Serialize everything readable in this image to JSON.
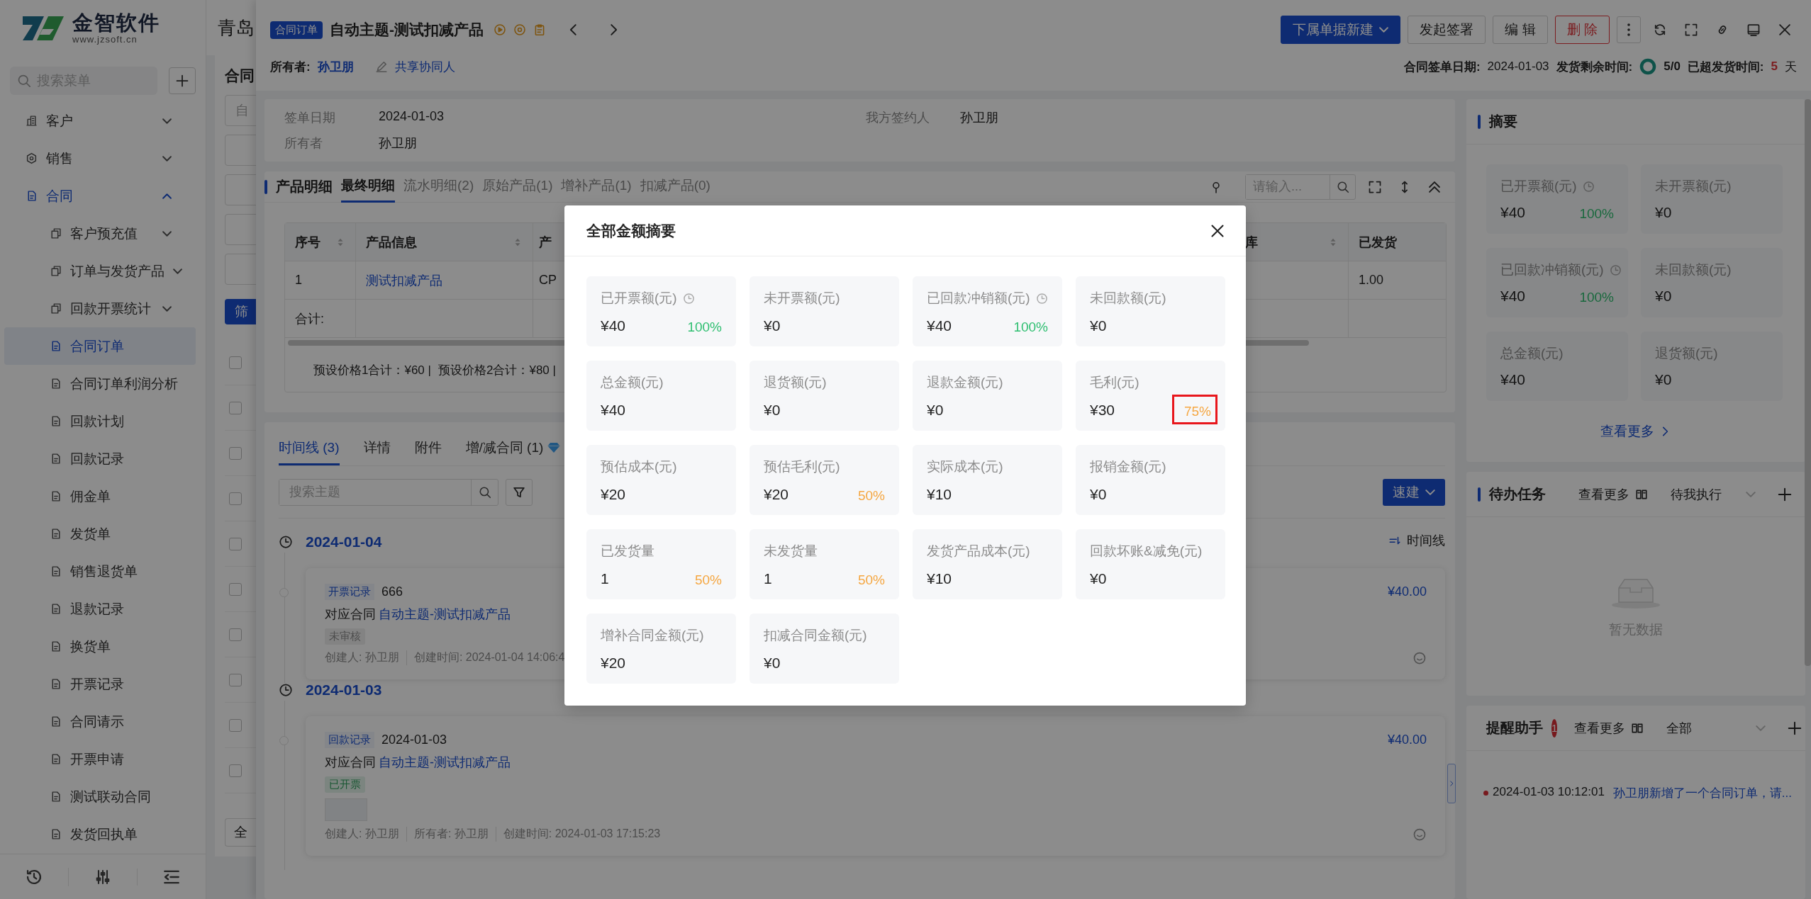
{
  "sidebar": {
    "logo": {
      "brand": "金智软件",
      "url": "www.jzsoft.cn"
    },
    "search": {
      "placeholder": "搜索菜单"
    },
    "items": [
      {
        "label": "客户",
        "expanded": false
      },
      {
        "label": "销售",
        "expanded": false
      },
      {
        "label": "合同",
        "expanded": true,
        "children": [
          {
            "label": "客户预充值",
            "kind": "group",
            "expanded": false,
            "selected": false
          },
          {
            "label": "订单与发货产品",
            "kind": "group",
            "expanded": false,
            "selected": false
          },
          {
            "label": "回款开票统计",
            "kind": "group",
            "expanded": false,
            "selected": false
          },
          {
            "label": "合同订单",
            "kind": "page",
            "selected": true
          },
          {
            "label": "合同订单利润分析",
            "kind": "page",
            "selected": false
          },
          {
            "label": "回款计划",
            "kind": "page",
            "selected": false
          },
          {
            "label": "回款记录",
            "kind": "page",
            "selected": false
          },
          {
            "label": "佣金单",
            "kind": "page",
            "selected": false
          },
          {
            "label": "发货单",
            "kind": "page",
            "selected": false
          },
          {
            "label": "销售退货单",
            "kind": "page",
            "selected": false
          },
          {
            "label": "退款记录",
            "kind": "page",
            "selected": false
          },
          {
            "label": "换货单",
            "kind": "page",
            "selected": false
          },
          {
            "label": "开票记录",
            "kind": "page",
            "selected": false
          },
          {
            "label": "合同请示",
            "kind": "page",
            "selected": false
          },
          {
            "label": "开票申请",
            "kind": "page",
            "selected": false
          },
          {
            "label": "测试联动合同",
            "kind": "page",
            "selected": false
          },
          {
            "label": "发货回执单",
            "kind": "page",
            "selected": false
          }
        ]
      }
    ]
  },
  "list_page": {
    "title": "青岛",
    "heading": "合同",
    "filter": {
      "placeholder": "自"
    },
    "filter_button": "筛",
    "rows": [
      {
        "checked": false
      },
      {
        "checked": false
      },
      {
        "checked": false
      },
      {
        "checked": false
      },
      {
        "checked": false
      },
      {
        "checked": false
      },
      {
        "checked": false
      },
      {
        "checked": false
      },
      {
        "checked": false
      },
      {
        "checked": false
      }
    ],
    "page_size": "全"
  },
  "drawer": {
    "header": {
      "badge": "合同订单",
      "title": "自动主题-测试扣减产品",
      "actions": [
        {
          "label": "下属单据新建",
          "kind": "dropdown"
        },
        {
          "label": "发起签署",
          "kind": "default"
        },
        {
          "label": "编 辑",
          "kind": "default"
        },
        {
          "label": "删 除",
          "kind": "danger"
        }
      ],
      "owner_label": "所有者:",
      "owner": "孙卫朋",
      "share_link": "共享协同人",
      "sign_date_label": "合同签单日期:",
      "sign_date": "2024-01-03",
      "remaining_label": "发货剩余时间:",
      "remaining": "5/0",
      "overdue_label": "已超发货时间:",
      "overdue": "5",
      "overdue_unit": "天"
    },
    "info": {
      "fields": [
        {
          "label": "签单日期",
          "value": "2024-01-03"
        },
        {
          "label": "我方签约人",
          "value": "孙卫朋"
        },
        {
          "label": "所有者",
          "value": "孙卫朋"
        }
      ]
    },
    "products": {
      "title": "产品明细",
      "tabs": [
        {
          "label": "最终明细",
          "selected": true
        },
        {
          "label": "流水明细(2)",
          "selected": false
        },
        {
          "label": "原始产品(1)",
          "selected": false
        },
        {
          "label": "增补产品(1)",
          "selected": false
        },
        {
          "label": "扣减产品(0)",
          "selected": false
        }
      ],
      "search": {
        "placeholder": "请输入..."
      },
      "columns": [
        {
          "label": "序号",
          "sortable": true
        },
        {
          "label": "产品信息",
          "sortable": true
        },
        {
          "label": "产",
          "sortable": false
        },
        {
          "label": "库",
          "sortable": true
        },
        {
          "label": "已发货",
          "sortable": false
        }
      ],
      "rows": [
        {
          "index": "1",
          "product": "测试扣减产品",
          "column_3": "CP",
          "shipped": "1.00"
        }
      ],
      "total_label": "合计:",
      "footer": [
        "预设价格1合计：¥60 |",
        "预设价格2合计：¥80 |"
      ]
    },
    "timeline": {
      "tabs": [
        {
          "label": "时间线 (3)",
          "selected": true,
          "premium": false
        },
        {
          "label": "详情",
          "selected": false,
          "premium": false
        },
        {
          "label": "附件",
          "selected": false,
          "premium": false
        },
        {
          "label": "增/减合同 (1)",
          "selected": false,
          "premium": true
        }
      ],
      "search": {
        "placeholder": "搜索主题"
      },
      "quick_button": "速建",
      "view_toggle": "时间线",
      "groups": [
        {
          "date": "2024-01-04",
          "entries": [
            {
              "tag": "开票记录",
              "title": "666",
              "contract_label": "对应合同",
              "contract": "自动主题-测试扣减产品",
              "status": "未审核",
              "color": "#4d4d4d",
              "has_attachment": false,
              "meta": [
                "创建人: 孙卫朋",
                "创建时间: 2024-01-04 14:06:4"
              ],
              "amount": "¥40.00"
            }
          ]
        },
        {
          "date": "2024-01-03",
          "entries": [
            {
              "tag": "回款记录",
              "title": "2024-01-03",
              "contract_label": "对应合同",
              "contract": "自动主题-测试扣减产品",
              "status": "已开票",
              "color": "#195732",
              "has_attachment": true,
              "meta": [
                "创建人: 孙卫朋",
                "所有者: 孙卫朋",
                "创建时间: 2024-01-03 17:15:23"
              ],
              "amount": "¥40.00"
            }
          ]
        }
      ]
    },
    "side": {
      "summary": {
        "title": "摘要",
        "cards": [
          {
            "label": "已开票额(元)",
            "hint": true,
            "value": "¥40",
            "percent": "100%",
            "color": "#1a693e"
          },
          {
            "label": "未开票额(元)",
            "hint": false,
            "value": "¥0"
          },
          {
            "label": "已回款冲销额(元)",
            "hint": true,
            "value": "¥40",
            "percent": "100%",
            "color": "#1a693e"
          },
          {
            "label": "未回款额(元)",
            "hint": false,
            "value": "¥0"
          },
          {
            "label": "总金额(元)",
            "hint": false,
            "value": "¥40"
          },
          {
            "label": "退货额(元)",
            "hint": false,
            "value": "¥0"
          }
        ],
        "more": "查看更多"
      },
      "tasks": {
        "title": "待办任务",
        "more": "查看更多",
        "filter": "待我执行",
        "empty": "暂无数据"
      },
      "reminders": {
        "title": "提醒助手",
        "count": "1",
        "more": "查看更多",
        "filter": "全部",
        "items": [
          {
            "time": "2024-01-03 10:12:01",
            "text": "孙卫朋新增了一个合同订单，请..."
          }
        ]
      }
    }
  },
  "modal": {
    "title": "全部金额摘要",
    "cards": [
      {
        "label": "已开票额(元)",
        "hint": true,
        "value": "¥40",
        "percent": "100%",
        "color": "#2fbf71",
        "highlighted": false
      },
      {
        "label": "未开票额(元)",
        "hint": false,
        "value": "¥0"
      },
      {
        "label": "已回款冲销额(元)",
        "hint": true,
        "value": "¥40",
        "percent": "100%",
        "color": "#2fbf71",
        "highlighted": false
      },
      {
        "label": "未回款额(元)",
        "hint": false,
        "value": "¥0"
      },
      {
        "label": "总金额(元)",
        "hint": false,
        "value": "¥40"
      },
      {
        "label": "退货额(元)",
        "hint": false,
        "value": "¥0"
      },
      {
        "label": "退款金额(元)",
        "hint": false,
        "value": "¥0"
      },
      {
        "label": "毛利(元)",
        "hint": false,
        "value": "¥30",
        "percent": "75%",
        "color": "#f5a742",
        "highlighted": true
      },
      {
        "label": "预估成本(元)",
        "hint": false,
        "value": "¥20"
      },
      {
        "label": "预估毛利(元)",
        "hint": false,
        "value": "¥20",
        "percent": "50%",
        "color": "#f5a742",
        "highlighted": false
      },
      {
        "label": "实际成本(元)",
        "hint": false,
        "value": "¥10"
      },
      {
        "label": "报销金额(元)",
        "hint": false,
        "value": "¥0"
      },
      {
        "label": "已发货量",
        "hint": false,
        "value": "1",
        "percent": "50%",
        "color": "#f5a742",
        "highlighted": false
      },
      {
        "label": "未发货量",
        "hint": false,
        "value": "1",
        "percent": "50%",
        "color": "#f5a742",
        "highlighted": false
      },
      {
        "label": "发货产品成本(元)",
        "hint": false,
        "value": "¥10"
      },
      {
        "label": "回款坏账&减免(元)",
        "hint": false,
        "value": "¥0"
      },
      {
        "label": "增补合同金额(元)",
        "hint": false,
        "value": "¥20"
      },
      {
        "label": "扣减合同金额(元)",
        "hint": false,
        "value": "¥0"
      }
    ]
  }
}
